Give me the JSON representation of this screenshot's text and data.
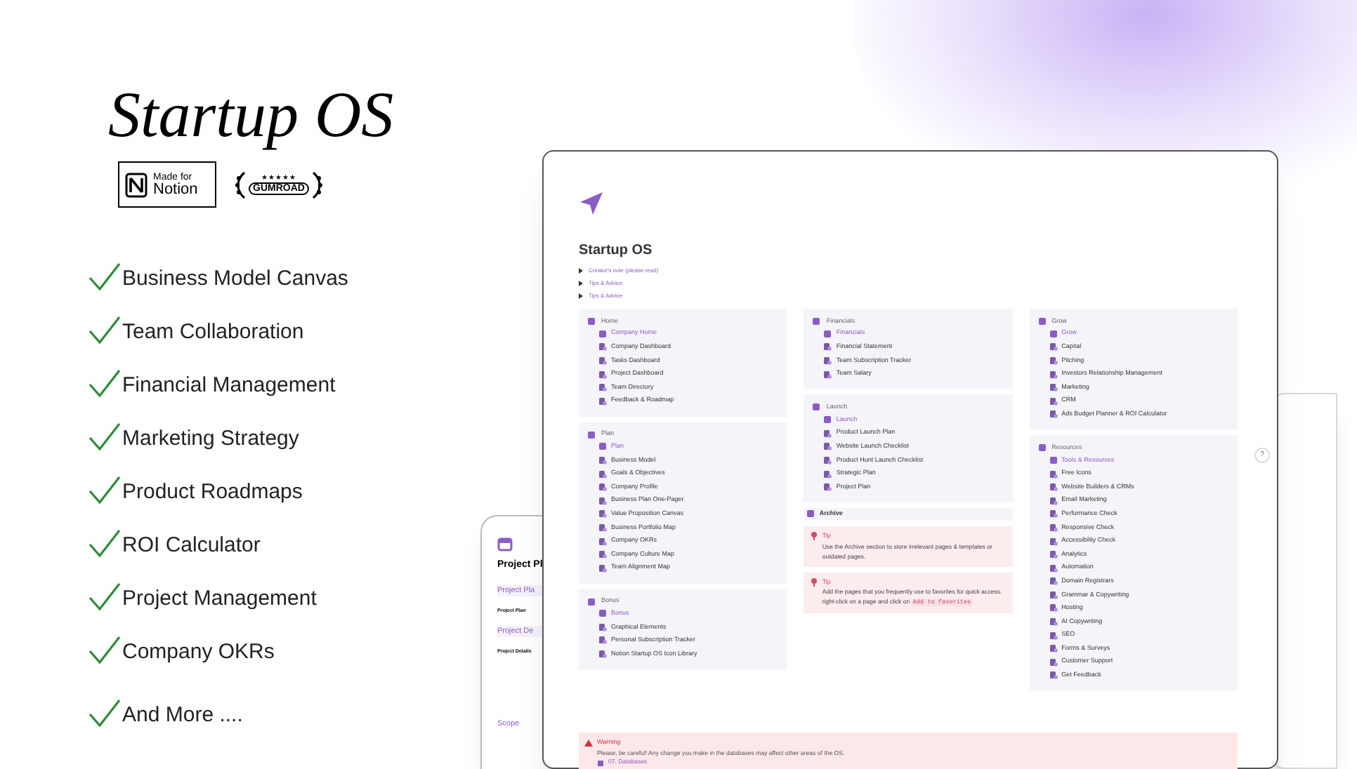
{
  "promo": {
    "title": "Startup OS",
    "badges": [
      {
        "kind": "notion",
        "line_1": "Made for",
        "line_2": "Notion"
      },
      {
        "kind": "gumroad",
        "stars": "★★★★★",
        "label": "GUMROAD"
      }
    ],
    "features": [
      "Business Model Canvas",
      "Team Collaboration",
      "Financial Management",
      "Marketing Strategy",
      "Product Roadmaps",
      "ROI Calculator",
      "Project Management",
      "Company OKRs",
      "And More ...."
    ]
  },
  "back_page": {
    "title": "Project Pl",
    "blocks": [
      {
        "heading": "Project Pla",
        "row": "Project Plan"
      },
      {
        "heading": "Project De",
        "row": "Project Details"
      }
    ],
    "footer": "Scope"
  },
  "page": {
    "title": "Startup OS",
    "toggles": [
      "Creator's note (please read)",
      "Tips & Advice",
      "Tips & Advice"
    ],
    "columns": [
      [
        {
          "kind": "section",
          "title": "Home",
          "items": [
            {
              "label": "Company Home",
              "kind": "link"
            },
            {
              "label": "Company Dashboard",
              "kind": "page"
            },
            {
              "label": "Tasks Dashboard",
              "kind": "page"
            },
            {
              "label": "Project Dashboard",
              "kind": "page"
            },
            {
              "label": "Team Directory",
              "kind": "page"
            },
            {
              "label": "Feedback & Roadmap",
              "kind": "page"
            }
          ]
        },
        {
          "kind": "section",
          "title": "Plan",
          "items": [
            {
              "label": "Plan",
              "kind": "link"
            },
            {
              "label": "Business Model",
              "kind": "page"
            },
            {
              "label": "Goals & Objectives",
              "kind": "page"
            },
            {
              "label": "Company Profile",
              "kind": "page"
            },
            {
              "label": "Business Plan One-Pager",
              "kind": "page"
            },
            {
              "label": "Value Proposition Canvas",
              "kind": "page"
            },
            {
              "label": "Business Portfolio Map",
              "kind": "page"
            },
            {
              "label": "Company OKRs",
              "kind": "page"
            },
            {
              "label": "Company Culture Map",
              "kind": "page"
            },
            {
              "label": "Team Alignment Map",
              "kind": "page"
            }
          ]
        },
        {
          "kind": "section",
          "title": "Bonus",
          "items": [
            {
              "label": "Bonus",
              "kind": "link"
            },
            {
              "label": "Graphical Elements",
              "kind": "page"
            },
            {
              "label": "Personal Subscription Tracker",
              "kind": "page"
            },
            {
              "label": "Notion Startup OS Icon Library",
              "kind": "page"
            }
          ]
        }
      ],
      [
        {
          "kind": "section",
          "title": "Financials",
          "items": [
            {
              "label": "Financials",
              "kind": "link"
            },
            {
              "label": "Financial Statement",
              "kind": "page"
            },
            {
              "label": "Team Subscription Tracker",
              "kind": "page"
            },
            {
              "label": "Team Salary",
              "kind": "page"
            }
          ]
        },
        {
          "kind": "section",
          "title": "Launch",
          "items": [
            {
              "label": "Launch",
              "kind": "link"
            },
            {
              "label": "Product Launch Plan",
              "kind": "page"
            },
            {
              "label": "Website Launch Checklist",
              "kind": "page"
            },
            {
              "label": "Product Hunt Launch Checklist",
              "kind": "page"
            },
            {
              "label": "Strategic Plan",
              "kind": "page"
            },
            {
              "label": "Project Plan",
              "kind": "page"
            }
          ]
        },
        {
          "kind": "bar",
          "title": "Archive"
        },
        {
          "kind": "tip",
          "title": "Tip",
          "text": "Use the Archive section to store irrelevant pages & templates or outdated pages."
        },
        {
          "kind": "tip",
          "title": "Tip",
          "text": "Add the pages that you frequently use to favorites for quick access. right-click on a page and click on",
          "code": "Add to favorites"
        }
      ],
      [
        {
          "kind": "section",
          "title": "Grow",
          "items": [
            {
              "label": "Grow",
              "kind": "link"
            },
            {
              "label": "Capital",
              "kind": "page"
            },
            {
              "label": "Pitching",
              "kind": "page"
            },
            {
              "label": "Investors Relationship Management",
              "kind": "page"
            },
            {
              "label": "Marketing",
              "kind": "page"
            },
            {
              "label": "CRM",
              "kind": "page"
            },
            {
              "label": "Ads Budget Planner & ROI Calculator",
              "kind": "page"
            }
          ]
        },
        {
          "kind": "section",
          "title": "Resources",
          "items": [
            {
              "label": "Tools & Resources",
              "kind": "link"
            },
            {
              "label": "Free Icons",
              "kind": "page"
            },
            {
              "label": "Website Builders & CRMs",
              "kind": "page"
            },
            {
              "label": "Email Marketing",
              "kind": "page"
            },
            {
              "label": "Performance Check",
              "kind": "page"
            },
            {
              "label": "Responsive Check",
              "kind": "page"
            },
            {
              "label": "Accessibility Check",
              "kind": "page"
            },
            {
              "label": "Analytics",
              "kind": "page"
            },
            {
              "label": "Automation",
              "kind": "page"
            },
            {
              "label": "Domain Registrars",
              "kind": "page"
            },
            {
              "label": "Grammar & Copywriting",
              "kind": "page"
            },
            {
              "label": "Hosting",
              "kind": "page"
            },
            {
              "label": "AI Copywriting",
              "kind": "page"
            },
            {
              "label": "SEO",
              "kind": "page"
            },
            {
              "label": "Forms & Surveys",
              "kind": "page"
            },
            {
              "label": "Customer Support",
              "kind": "page"
            },
            {
              "label": "Get Feedback",
              "kind": "page"
            }
          ]
        }
      ]
    ],
    "warning": {
      "title": "Warning",
      "text": "Please, be careful! Any change you make in the databases may affect other areas of the OS.",
      "link": "07. Databases"
    },
    "help": "?"
  }
}
